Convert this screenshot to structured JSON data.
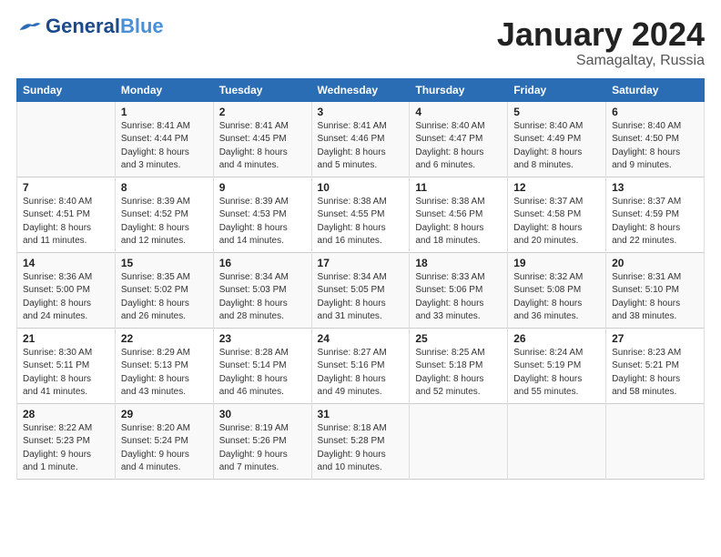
{
  "header": {
    "logo_line1": "General",
    "logo_line2": "Blue",
    "month_title": "January 2024",
    "location": "Samagaltay, Russia"
  },
  "days_of_week": [
    "Sunday",
    "Monday",
    "Tuesday",
    "Wednesday",
    "Thursday",
    "Friday",
    "Saturday"
  ],
  "weeks": [
    {
      "days": [
        {
          "num": "",
          "info": ""
        },
        {
          "num": "1",
          "info": "Sunrise: 8:41 AM\nSunset: 4:44 PM\nDaylight: 8 hours\nand 3 minutes."
        },
        {
          "num": "2",
          "info": "Sunrise: 8:41 AM\nSunset: 4:45 PM\nDaylight: 8 hours\nand 4 minutes."
        },
        {
          "num": "3",
          "info": "Sunrise: 8:41 AM\nSunset: 4:46 PM\nDaylight: 8 hours\nand 5 minutes."
        },
        {
          "num": "4",
          "info": "Sunrise: 8:40 AM\nSunset: 4:47 PM\nDaylight: 8 hours\nand 6 minutes."
        },
        {
          "num": "5",
          "info": "Sunrise: 8:40 AM\nSunset: 4:49 PM\nDaylight: 8 hours\nand 8 minutes."
        },
        {
          "num": "6",
          "info": "Sunrise: 8:40 AM\nSunset: 4:50 PM\nDaylight: 8 hours\nand 9 minutes."
        }
      ]
    },
    {
      "days": [
        {
          "num": "7",
          "info": "Sunrise: 8:40 AM\nSunset: 4:51 PM\nDaylight: 8 hours\nand 11 minutes."
        },
        {
          "num": "8",
          "info": "Sunrise: 8:39 AM\nSunset: 4:52 PM\nDaylight: 8 hours\nand 12 minutes."
        },
        {
          "num": "9",
          "info": "Sunrise: 8:39 AM\nSunset: 4:53 PM\nDaylight: 8 hours\nand 14 minutes."
        },
        {
          "num": "10",
          "info": "Sunrise: 8:38 AM\nSunset: 4:55 PM\nDaylight: 8 hours\nand 16 minutes."
        },
        {
          "num": "11",
          "info": "Sunrise: 8:38 AM\nSunset: 4:56 PM\nDaylight: 8 hours\nand 18 minutes."
        },
        {
          "num": "12",
          "info": "Sunrise: 8:37 AM\nSunset: 4:58 PM\nDaylight: 8 hours\nand 20 minutes."
        },
        {
          "num": "13",
          "info": "Sunrise: 8:37 AM\nSunset: 4:59 PM\nDaylight: 8 hours\nand 22 minutes."
        }
      ]
    },
    {
      "days": [
        {
          "num": "14",
          "info": "Sunrise: 8:36 AM\nSunset: 5:00 PM\nDaylight: 8 hours\nand 24 minutes."
        },
        {
          "num": "15",
          "info": "Sunrise: 8:35 AM\nSunset: 5:02 PM\nDaylight: 8 hours\nand 26 minutes."
        },
        {
          "num": "16",
          "info": "Sunrise: 8:34 AM\nSunset: 5:03 PM\nDaylight: 8 hours\nand 28 minutes."
        },
        {
          "num": "17",
          "info": "Sunrise: 8:34 AM\nSunset: 5:05 PM\nDaylight: 8 hours\nand 31 minutes."
        },
        {
          "num": "18",
          "info": "Sunrise: 8:33 AM\nSunset: 5:06 PM\nDaylight: 8 hours\nand 33 minutes."
        },
        {
          "num": "19",
          "info": "Sunrise: 8:32 AM\nSunset: 5:08 PM\nDaylight: 8 hours\nand 36 minutes."
        },
        {
          "num": "20",
          "info": "Sunrise: 8:31 AM\nSunset: 5:10 PM\nDaylight: 8 hours\nand 38 minutes."
        }
      ]
    },
    {
      "days": [
        {
          "num": "21",
          "info": "Sunrise: 8:30 AM\nSunset: 5:11 PM\nDaylight: 8 hours\nand 41 minutes."
        },
        {
          "num": "22",
          "info": "Sunrise: 8:29 AM\nSunset: 5:13 PM\nDaylight: 8 hours\nand 43 minutes."
        },
        {
          "num": "23",
          "info": "Sunrise: 8:28 AM\nSunset: 5:14 PM\nDaylight: 8 hours\nand 46 minutes."
        },
        {
          "num": "24",
          "info": "Sunrise: 8:27 AM\nSunset: 5:16 PM\nDaylight: 8 hours\nand 49 minutes."
        },
        {
          "num": "25",
          "info": "Sunrise: 8:25 AM\nSunset: 5:18 PM\nDaylight: 8 hours\nand 52 minutes."
        },
        {
          "num": "26",
          "info": "Sunrise: 8:24 AM\nSunset: 5:19 PM\nDaylight: 8 hours\nand 55 minutes."
        },
        {
          "num": "27",
          "info": "Sunrise: 8:23 AM\nSunset: 5:21 PM\nDaylight: 8 hours\nand 58 minutes."
        }
      ]
    },
    {
      "days": [
        {
          "num": "28",
          "info": "Sunrise: 8:22 AM\nSunset: 5:23 PM\nDaylight: 9 hours\nand 1 minute."
        },
        {
          "num": "29",
          "info": "Sunrise: 8:20 AM\nSunset: 5:24 PM\nDaylight: 9 hours\nand 4 minutes."
        },
        {
          "num": "30",
          "info": "Sunrise: 8:19 AM\nSunset: 5:26 PM\nDaylight: 9 hours\nand 7 minutes."
        },
        {
          "num": "31",
          "info": "Sunrise: 8:18 AM\nSunset: 5:28 PM\nDaylight: 9 hours\nand 10 minutes."
        },
        {
          "num": "",
          "info": ""
        },
        {
          "num": "",
          "info": ""
        },
        {
          "num": "",
          "info": ""
        }
      ]
    }
  ]
}
